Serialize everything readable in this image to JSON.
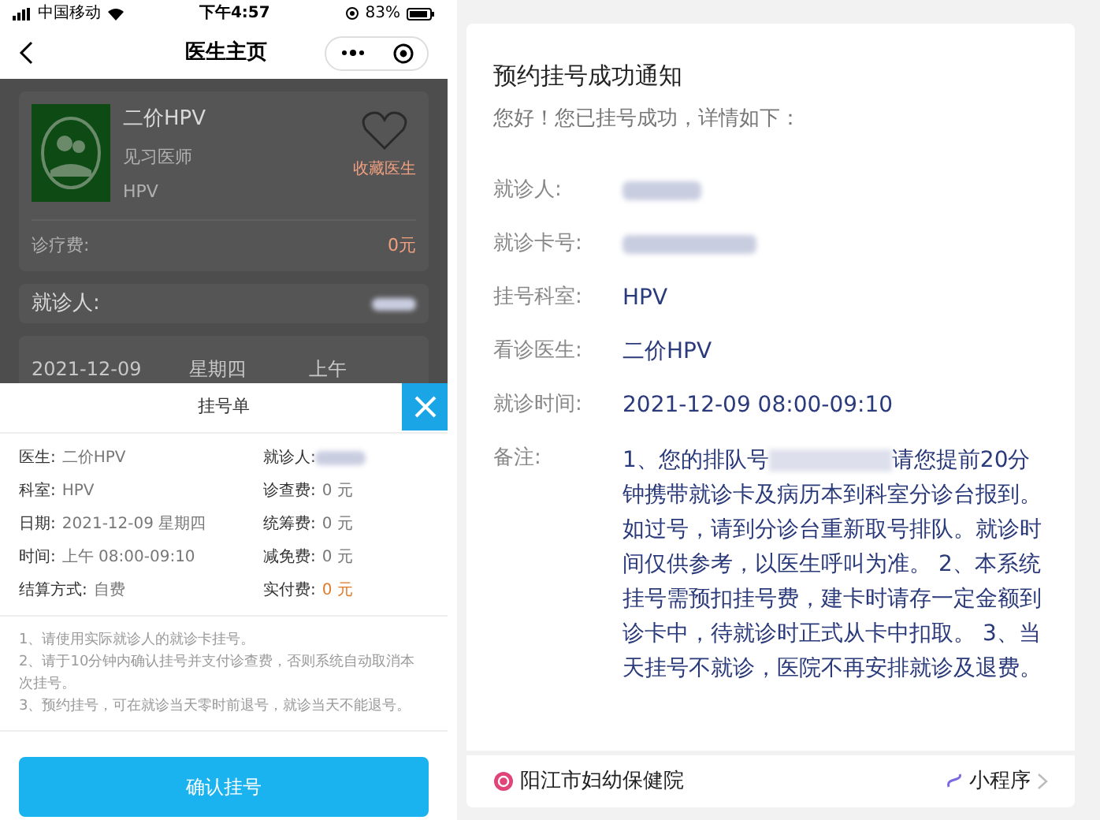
{
  "status_bar": {
    "carrier": "中国移动",
    "time": "下午4:57",
    "battery": "83%"
  },
  "nav_bar": {
    "title": "医生主页"
  },
  "doctor_card": {
    "name": "二价HPV",
    "title": "见习医师",
    "department": "HPV",
    "favorite_label": "收藏医生",
    "fee_label": "诊疗费:",
    "fee_value": "0元"
  },
  "patient_card": {
    "label": "就诊人:"
  },
  "schedule_row": {
    "date": "2021-12-09",
    "weekday": "星期四",
    "period": "上午"
  },
  "sheet": {
    "title": "挂号单",
    "fields": [
      {
        "label": "医生:",
        "value": "二价HPV",
        "redacted": false,
        "highlight": false
      },
      {
        "label": "就诊人:",
        "redacted": true
      },
      {
        "label": "科室:",
        "value": "HPV",
        "redacted": false,
        "highlight": false
      },
      {
        "label": "诊查费:",
        "value": "0 元",
        "redacted": false,
        "highlight": false
      },
      {
        "label": "日期:",
        "value": "2021-12-09 星期四",
        "redacted": false,
        "highlight": false
      },
      {
        "label": "统筹费:",
        "value": "0 元",
        "redacted": false,
        "highlight": false
      },
      {
        "label": "时间:",
        "value": "上午 08:00-09:10",
        "redacted": false,
        "highlight": false
      },
      {
        "label": "减免费:",
        "value": "0 元",
        "redacted": false,
        "highlight": false
      },
      {
        "label": "结算方式:",
        "value": "自费",
        "redacted": false,
        "highlight": false
      },
      {
        "label": "实付费:",
        "value": "0 元",
        "redacted": false,
        "highlight": true
      }
    ],
    "notes": [
      "1、请使用实际就诊人的就诊卡挂号。",
      "2、请于10分钟内确认挂号并支付诊查费，否则系统自动取消本次挂号。",
      "3、预约挂号，可在就诊当天零时前退号，就诊当天不能退号。"
    ],
    "confirm_button": "确认挂号"
  },
  "notice": {
    "title": "预约挂号成功通知",
    "greeting": "您好！您已挂号成功，详情如下：",
    "rows": [
      {
        "label": "就诊人:",
        "redacted": true
      },
      {
        "label": "就诊卡号:",
        "redacted": true
      },
      {
        "label": "挂号科室:",
        "value": "HPV",
        "redacted": false
      },
      {
        "label": "看诊医生:",
        "value": "二价HPV",
        "redacted": false
      },
      {
        "label": "就诊时间:",
        "value": "2021-12-09 08:00-09:10",
        "redacted": false
      }
    ],
    "remark_label": "备注:",
    "remark_start": "1、您的排队号",
    "remark_rest": "请您提前20分钟携带就诊卡及病历本到科室分诊台报到。如过号，请到分诊台重新取号排队。就诊时间仅供参考，以医生呼叫为准。 2、本系统挂号需预扣挂号费，建卡时请存一定金额到诊卡中，待就诊时正式从卡中扣取。 3、当天挂号不就诊，医院不再安排就诊及退费。",
    "source": "阳江市妇幼保健院",
    "mini_program": "小程序"
  }
}
